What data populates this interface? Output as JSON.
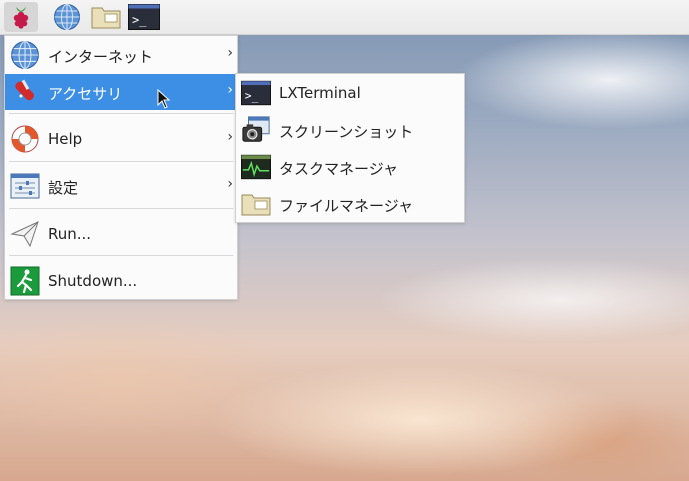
{
  "taskbar": {
    "buttons": [
      {
        "name": "raspberry-menu-button",
        "icon": "raspberry-icon"
      },
      {
        "name": "web-browser-button",
        "icon": "globe-icon"
      },
      {
        "name": "file-manager-button",
        "icon": "folder-icon"
      },
      {
        "name": "terminal-button",
        "icon": "terminal-icon"
      }
    ]
  },
  "main_menu": {
    "items": [
      {
        "label": "インターネット",
        "icon": "globe-icon",
        "submenu": true
      },
      {
        "label": "アクセサリ",
        "icon": "knife-icon",
        "submenu": true,
        "highlighted": true
      },
      {
        "label": "Help",
        "icon": "lifebuoy-icon",
        "submenu": true
      },
      {
        "label": "設定",
        "icon": "settings-panel-icon",
        "submenu": true
      },
      {
        "label": "Run...",
        "icon": "paper-plane-icon",
        "submenu": false
      },
      {
        "label": "Shutdown...",
        "icon": "exit-running-man-icon",
        "submenu": false
      }
    ],
    "arrow": "›"
  },
  "accessories_submenu": {
    "items": [
      {
        "label": "LXTerminal",
        "icon": "terminal-icon"
      },
      {
        "label": "スクリーンショット",
        "icon": "camera-icon"
      },
      {
        "label": "タスクマネージャ",
        "icon": "task-monitor-icon"
      },
      {
        "label": "ファイルマネージャ",
        "icon": "folder-icon"
      }
    ]
  },
  "colors": {
    "highlight": "#3d8fe6",
    "menu_bg": "#fbfbfb"
  }
}
